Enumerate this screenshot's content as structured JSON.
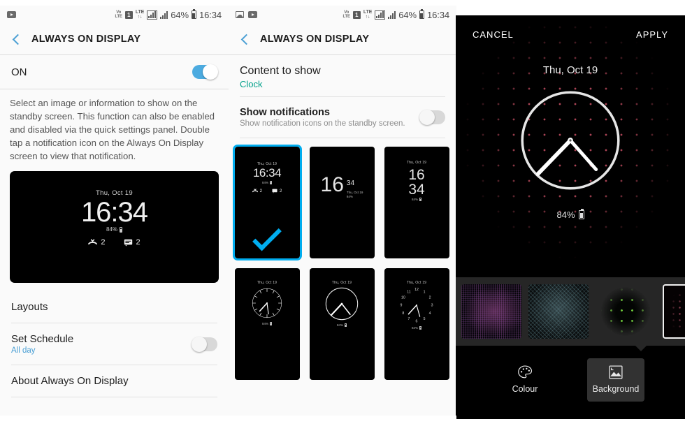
{
  "status_bar": {
    "left_icons_p1": [
      "youtube-icon"
    ],
    "left_icons_p2": [
      "gallery-icon",
      "youtube-icon"
    ],
    "volte": "VoLTE",
    "sim": "1",
    "lte": "LTE",
    "battery_percent": "64%",
    "time": "16:34"
  },
  "panel1": {
    "app_title": "ALWAYS ON DISPLAY",
    "master_label": "ON",
    "master_state": "on",
    "description": "Select an image or information to show on the standby screen. This function can also be enabled and disabled via the quick settings panel. Double tap a notification icon on the Always On Display screen to view that notification.",
    "preview": {
      "date": "Thu, Oct 19",
      "time": "16:34",
      "battery": "84%",
      "notifications": [
        {
          "icon": "missed-call-icon",
          "count": "2"
        },
        {
          "icon": "message-icon",
          "count": "2"
        }
      ]
    },
    "rows": [
      {
        "title": "Layouts",
        "subtitle": "",
        "toggle": "none"
      },
      {
        "title": "Set Schedule",
        "subtitle": "All day",
        "toggle": "off"
      },
      {
        "title": "About Always On Display",
        "subtitle": "",
        "toggle": "none"
      }
    ]
  },
  "panel2": {
    "app_title": "ALWAYS ON DISPLAY",
    "content_to_show": {
      "title": "Content to show",
      "value": "Clock"
    },
    "show_notifications": {
      "title": "Show notifications",
      "subtitle": "Show notification icons on the standby screen.",
      "toggle": "off"
    },
    "common": {
      "date": "Thu, Oct 19",
      "battery": "84%",
      "hour": "16",
      "minute": "34"
    },
    "layouts": [
      {
        "name": "digital-with-notifications",
        "selected": true,
        "type": "digital-colon",
        "notifications": [
          {
            "icon": "missed-call-icon",
            "count": "2"
          },
          {
            "icon": "message-icon",
            "count": "2"
          }
        ]
      },
      {
        "name": "digital-big-hour-side",
        "selected": false,
        "type": "digital-side"
      },
      {
        "name": "digital-stacked",
        "selected": false,
        "type": "digital-stacked"
      },
      {
        "name": "analog-ticks",
        "selected": false,
        "type": "analog-ticks"
      },
      {
        "name": "analog-plain",
        "selected": false,
        "type": "analog-plain"
      },
      {
        "name": "analog-numbers",
        "selected": false,
        "type": "analog-numbers",
        "numbers": [
          "12",
          "1",
          "2",
          "3",
          "4",
          "5",
          "6",
          "7",
          "8",
          "9",
          "10",
          "11"
        ]
      }
    ]
  },
  "panel3": {
    "cancel_label": "CANCEL",
    "apply_label": "APPLY",
    "date": "Thu, Oct 19",
    "battery": "84%",
    "clock_time": "16:34",
    "backgrounds": [
      {
        "name": "background-purple-grid",
        "selected": false
      },
      {
        "name": "background-teal-weave",
        "selected": false
      },
      {
        "name": "background-green-dots",
        "selected": false
      },
      {
        "name": "background-pink-dots",
        "selected": true
      }
    ],
    "tools": [
      {
        "name": "colour-tool",
        "label": "Colour",
        "icon": "palette-icon",
        "active": false
      },
      {
        "name": "background-tool",
        "label": "Background",
        "icon": "image-icon",
        "active": true
      }
    ]
  },
  "colors": {
    "accent_blue": "#4a9fd4",
    "toggle_on": "#4cabe0",
    "selection_cyan": "#00adef",
    "teal_value": "#00a08a",
    "panel_bg": "#fafafa",
    "dot_pink": "#b4485a"
  }
}
